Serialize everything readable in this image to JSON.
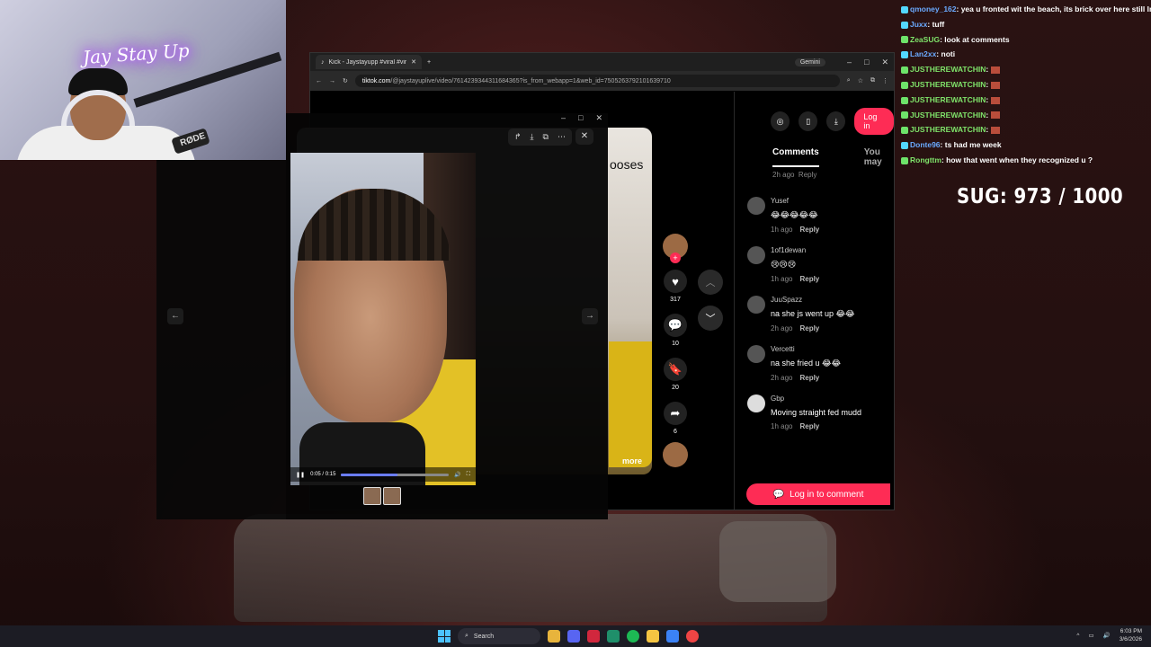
{
  "webcam": {
    "neon_sign": "Jay Stay Up",
    "mic_brand": "RØDE"
  },
  "browser": {
    "tab_title": "Kick - Jaystayupp #viral #viralvid",
    "gemini_label": "Gemini",
    "url_domain": "tiktok.com",
    "url_rest": "/@jaystayuplive/video/7614239344311684365?is_from_webapp=1&web_id=7505263792101639710"
  },
  "tiktok": {
    "video_overlay_text": "ooses",
    "more_label": "more",
    "like_count": "317",
    "comment_count": "10",
    "save_count": "20",
    "share_count": "6",
    "login_label": "Log in",
    "tabs": [
      "Comments",
      "You may"
    ],
    "first_meta": "2h ago",
    "first_reply": "Reply",
    "comments": [
      {
        "name": "Yusef",
        "text": "😂😂😂😂😂",
        "time": "1h ago",
        "reply": "Reply"
      },
      {
        "name": "1of1dewan",
        "text": "😢😢😢",
        "time": "1h ago",
        "reply": "Reply"
      },
      {
        "name": "JuuSpazz",
        "text": "na she js went up 😂😂",
        "time": "2h ago",
        "reply": "Reply"
      },
      {
        "name": "Vercetti",
        "text": "na she fried u 😂😂",
        "time": "2h ago",
        "reply": "Reply"
      },
      {
        "name": "Gbp",
        "text": "Moving straight fed mudd",
        "time": "1h ago",
        "reply": "Reply"
      }
    ],
    "login_to_comment": "Log in to comment"
  },
  "viewer": {
    "time_display": "0:05 / 0:15",
    "progress_fraction": 0.52
  },
  "chat": [
    {
      "user": "qmoney_162",
      "msg": "yea u fronted wit the beach, its brick over here still lmaoo",
      "color": "blue"
    },
    {
      "user": "Juxx",
      "msg": "tuff",
      "color": "blue"
    },
    {
      "user": "ZeaSUG",
      "msg": "look at comments",
      "color": "green"
    },
    {
      "user": "Lan2xx",
      "msg": "noti",
      "color": "blue"
    },
    {
      "user": "JUSTHEREWATCHIN",
      "msg": "",
      "color": "green"
    },
    {
      "user": "JUSTHEREWATCHIN",
      "msg": "",
      "color": "green"
    },
    {
      "user": "JUSTHEREWATCHIN",
      "msg": "",
      "color": "green"
    },
    {
      "user": "JUSTHEREWATCHIN",
      "msg": "",
      "color": "green"
    },
    {
      "user": "JUSTHEREWATCHIN",
      "msg": "",
      "color": "green"
    },
    {
      "user": "Donte96",
      "msg": "ts had me week",
      "color": "blue"
    },
    {
      "user": "Rongttm",
      "msg": "how that went when they recognized u ?",
      "color": "green"
    }
  ],
  "sug_counter": "SUG: 973 / 1000",
  "taskbar": {
    "search_placeholder": "Search",
    "time": "6:03 PM",
    "date": "3/6/2026"
  },
  "colors": {
    "tiktok_accent": "#fe2c55",
    "chat_green": "#7fe36a",
    "chat_blue": "#6aaaff"
  }
}
